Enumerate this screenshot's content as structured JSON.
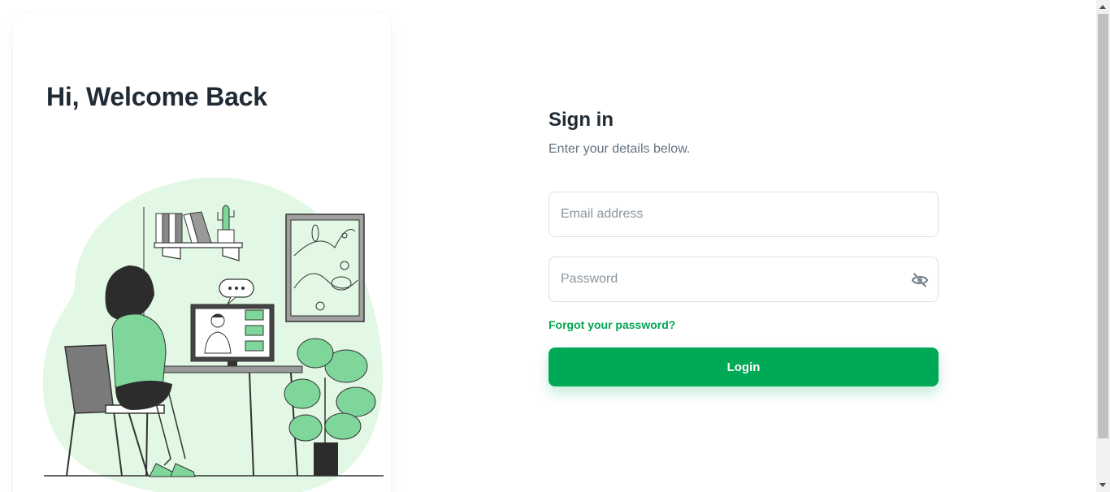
{
  "welcome": {
    "heading": "Hi, Welcome Back"
  },
  "signin": {
    "title": "Sign in",
    "subtitle": "Enter your details below.",
    "email_placeholder": "Email address",
    "password_placeholder": "Password",
    "password_toggle_icon": "eye-off-icon",
    "forgot_label": "Forgot your password?",
    "login_label": "Login"
  },
  "colors": {
    "primary": "#00A956",
    "link": "#00A550",
    "text_primary": "#212B36",
    "text_secondary": "#637381",
    "illustration_bg": "#E2F7E4"
  }
}
